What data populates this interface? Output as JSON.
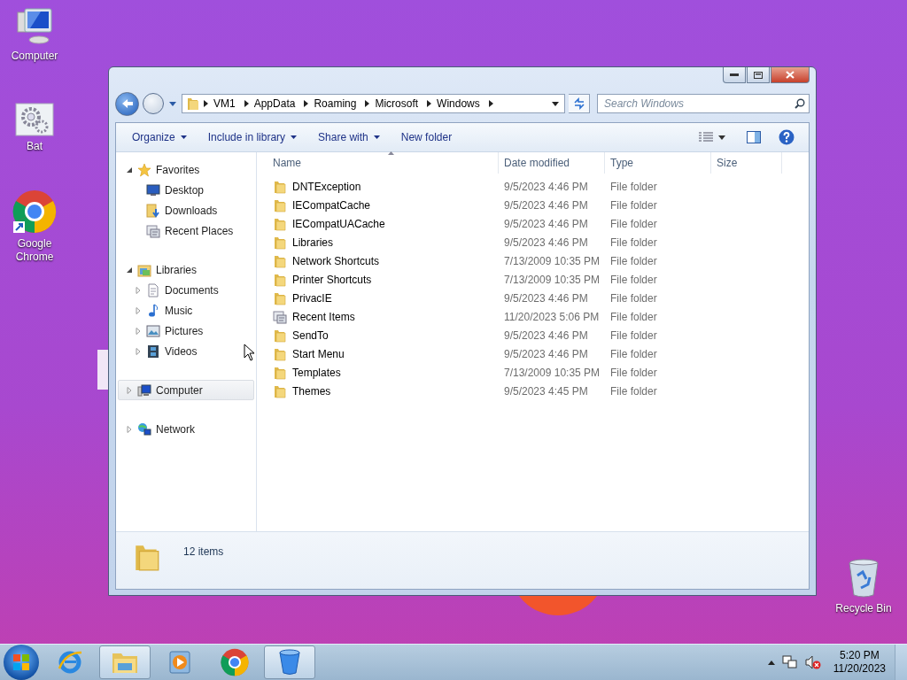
{
  "desktop_icons": [
    {
      "label": "Computer",
      "kind": "computer"
    },
    {
      "label": "Bat",
      "kind": "gears"
    },
    {
      "label": "Google Chrome",
      "kind": "chrome"
    },
    {
      "label": "Recycle Bin",
      "kind": "bin"
    }
  ],
  "window": {
    "breadcrumb": [
      "VM1",
      "AppData",
      "Roaming",
      "Microsoft",
      "Windows"
    ],
    "search": {
      "placeholder": "Search Windows"
    },
    "toolbar": [
      {
        "label": "Organize",
        "dropdown": true
      },
      {
        "label": "Include in library",
        "dropdown": true
      },
      {
        "label": "Share with",
        "dropdown": true
      },
      {
        "label": "New folder",
        "dropdown": false
      }
    ],
    "nav": [
      {
        "label": "Favorites",
        "kind": "star",
        "expanded": true,
        "selected": false,
        "children": [
          {
            "label": "Desktop",
            "kind": "desktop",
            "selected": false
          },
          {
            "label": "Downloads",
            "kind": "downloads",
            "selected": false
          },
          {
            "label": "Recent Places",
            "kind": "recent",
            "selected": false
          }
        ]
      },
      {
        "label": "Libraries",
        "kind": "library",
        "expanded": true,
        "selected": false,
        "children": [
          {
            "label": "Documents",
            "kind": "document",
            "expanded": false,
            "selected": false
          },
          {
            "label": "Music",
            "kind": "music",
            "expanded": false,
            "selected": false
          },
          {
            "label": "Pictures",
            "kind": "pictures",
            "expanded": false,
            "selected": false
          },
          {
            "label": "Videos",
            "kind": "videos",
            "expanded": false,
            "selected": false
          }
        ]
      },
      {
        "label": "Computer",
        "kind": "computer",
        "expanded": false,
        "selected": true
      },
      {
        "label": "Network",
        "kind": "network",
        "expanded": false,
        "selected": false
      }
    ],
    "columns": [
      "Name",
      "Date modified",
      "Type",
      "Size"
    ],
    "files": [
      {
        "name": "DNTException",
        "date": "9/5/2023 4:46 PM",
        "type": "File folder",
        "kind": "folder"
      },
      {
        "name": "IECompatCache",
        "date": "9/5/2023 4:46 PM",
        "type": "File folder",
        "kind": "folder"
      },
      {
        "name": "IECompatUACache",
        "date": "9/5/2023 4:46 PM",
        "type": "File folder",
        "kind": "folder"
      },
      {
        "name": "Libraries",
        "date": "9/5/2023 4:46 PM",
        "type": "File folder",
        "kind": "folder"
      },
      {
        "name": "Network Shortcuts",
        "date": "7/13/2009 10:35 PM",
        "type": "File folder",
        "kind": "folder"
      },
      {
        "name": "Printer Shortcuts",
        "date": "7/13/2009 10:35 PM",
        "type": "File folder",
        "kind": "folder"
      },
      {
        "name": "PrivacIE",
        "date": "9/5/2023 4:46 PM",
        "type": "File folder",
        "kind": "folder"
      },
      {
        "name": "Recent Items",
        "date": "11/20/2023 5:06 PM",
        "type": "File folder",
        "kind": "recent"
      },
      {
        "name": "SendTo",
        "date": "9/5/2023 4:46 PM",
        "type": "File folder",
        "kind": "folder"
      },
      {
        "name": "Start Menu",
        "date": "9/5/2023 4:46 PM",
        "type": "File folder",
        "kind": "folder"
      },
      {
        "name": "Templates",
        "date": "7/13/2009 10:35 PM",
        "type": "File folder",
        "kind": "folder"
      },
      {
        "name": "Themes",
        "date": "9/5/2023 4:45 PM",
        "type": "File folder",
        "kind": "folder"
      }
    ],
    "status": {
      "count": "12 items"
    }
  },
  "taskbar": {
    "apps": [
      {
        "kind": "ie",
        "running": false
      },
      {
        "kind": "explorer",
        "running": true
      },
      {
        "kind": "media",
        "running": false
      },
      {
        "kind": "chrome",
        "running": false
      },
      {
        "kind": "bin",
        "running": true
      }
    ],
    "time": "5:20 PM",
    "date": "11/20/2023"
  }
}
